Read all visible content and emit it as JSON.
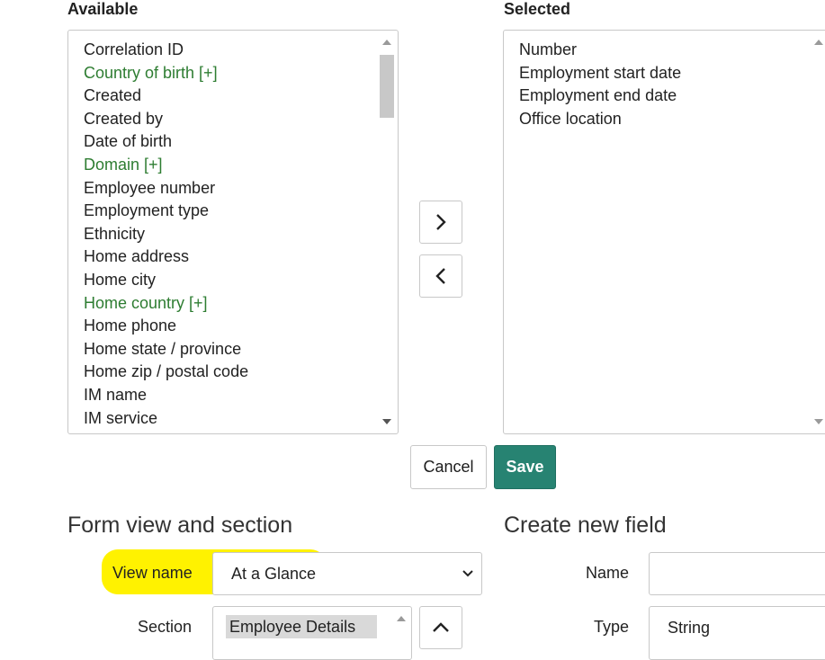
{
  "available": {
    "label": "Available",
    "items": [
      {
        "text": "Correlation ID",
        "green": false
      },
      {
        "text": "Country of birth [+]",
        "green": true
      },
      {
        "text": "Created",
        "green": false
      },
      {
        "text": "Created by",
        "green": false
      },
      {
        "text": "Date of birth",
        "green": false
      },
      {
        "text": "Domain [+]",
        "green": true
      },
      {
        "text": "Employee number",
        "green": false
      },
      {
        "text": "Employment type",
        "green": false
      },
      {
        "text": "Ethnicity",
        "green": false
      },
      {
        "text": "Home address",
        "green": false
      },
      {
        "text": "Home city",
        "green": false
      },
      {
        "text": "Home country [+]",
        "green": true
      },
      {
        "text": "Home phone",
        "green": false
      },
      {
        "text": "Home state / province",
        "green": false
      },
      {
        "text": "Home zip / postal code",
        "green": false
      },
      {
        "text": "IM name",
        "green": false
      },
      {
        "text": "IM service",
        "green": false
      }
    ]
  },
  "selected": {
    "label": "Selected",
    "items": [
      "Number",
      "Employment start date",
      "Employment end date",
      "Office location"
    ]
  },
  "actions": {
    "cancel_label": "Cancel",
    "save_label": "Save"
  },
  "form_view": {
    "heading": "Form view and section",
    "view_name_label": "View name",
    "view_name_value": "At a Glance",
    "section_label": "Section",
    "section_selected": "Employee Details"
  },
  "new_field": {
    "heading": "Create new field",
    "name_label": "Name",
    "name_value": "",
    "type_label": "Type",
    "type_value": "String"
  },
  "colors": {
    "accent": "#278372",
    "green_item": "#2e7d32",
    "highlight": "#fff200"
  }
}
